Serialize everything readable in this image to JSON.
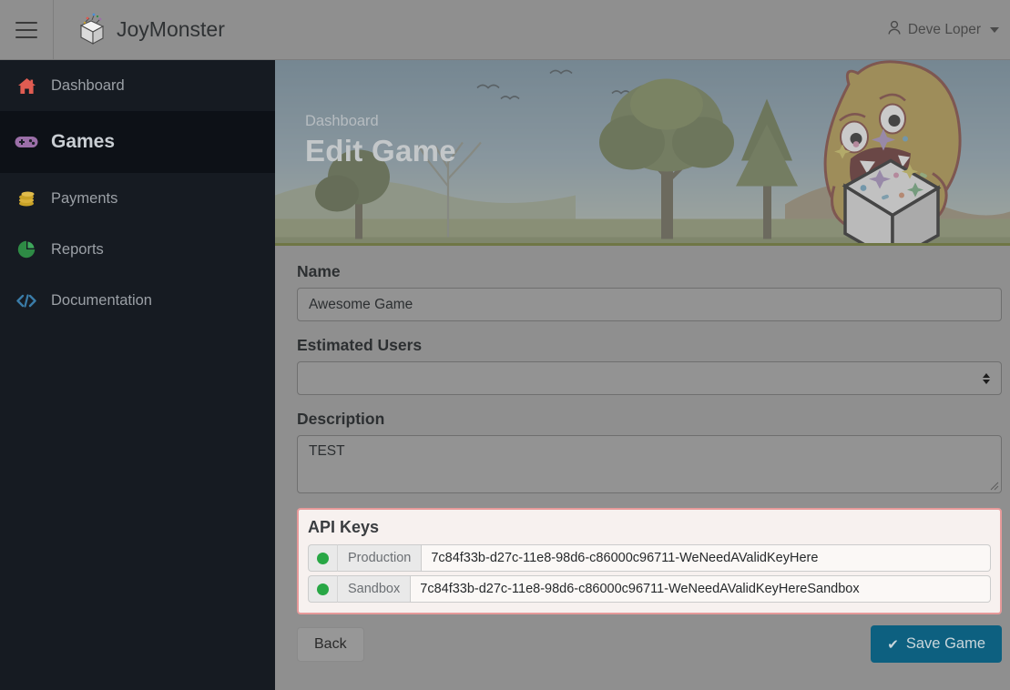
{
  "header": {
    "menu_icon": "hamburger-icon",
    "logo_icon": "gift-box-logo-icon",
    "brand_name_primary": "Joy",
    "brand_name_secondary": "Monster",
    "brand_name": "JoyMonster",
    "user_icon": "user-icon",
    "user_name": "Deve Loper",
    "caret_icon": "chevron-down-icon"
  },
  "sidebar": {
    "items": [
      {
        "label": "Dashboard",
        "icon": "home-icon",
        "icon_color": "#e05c52",
        "active": false
      },
      {
        "label": "Games",
        "icon": "gamepad-icon",
        "icon_color": "#9b6fa8",
        "active": true
      },
      {
        "label": "Payments",
        "icon": "coins-icon",
        "icon_color": "#c9a227",
        "active": false
      },
      {
        "label": "Reports",
        "icon": "pie-chart-icon",
        "icon_color": "#2e8b45",
        "active": false
      },
      {
        "label": "Documentation",
        "icon": "code-icon",
        "icon_color": "#3a7ca8",
        "active": false
      }
    ]
  },
  "hero": {
    "breadcrumb": "Dashboard",
    "title": "Edit Game",
    "illustration": "monster-with-gift-box-illustration"
  },
  "form": {
    "name": {
      "label": "Name",
      "value": "Awesome Game",
      "placeholder": ""
    },
    "estimated_users": {
      "label": "Estimated Users",
      "value": "",
      "options": []
    },
    "description": {
      "label": "Description",
      "value": "TEST",
      "placeholder": ""
    }
  },
  "api_keys": {
    "title": "API Keys",
    "rows": [
      {
        "status": "active",
        "status_color": "#28a745",
        "env": "Production",
        "key": "7c84f33b-d27c-11e8-98d6-c86000c96711-WeNeedAValidKeyHere"
      },
      {
        "status": "active",
        "status_color": "#28a745",
        "env": "Sandbox",
        "key": "7c84f33b-d27c-11e8-98d6-c86000c96711-WeNeedAValidKeyHereSandbox"
      }
    ],
    "border_color": "#e79a9a"
  },
  "footer": {
    "back_label": "Back",
    "save_label": "Save Game",
    "save_icon": "check-icon",
    "save_color": "#0d6080"
  }
}
